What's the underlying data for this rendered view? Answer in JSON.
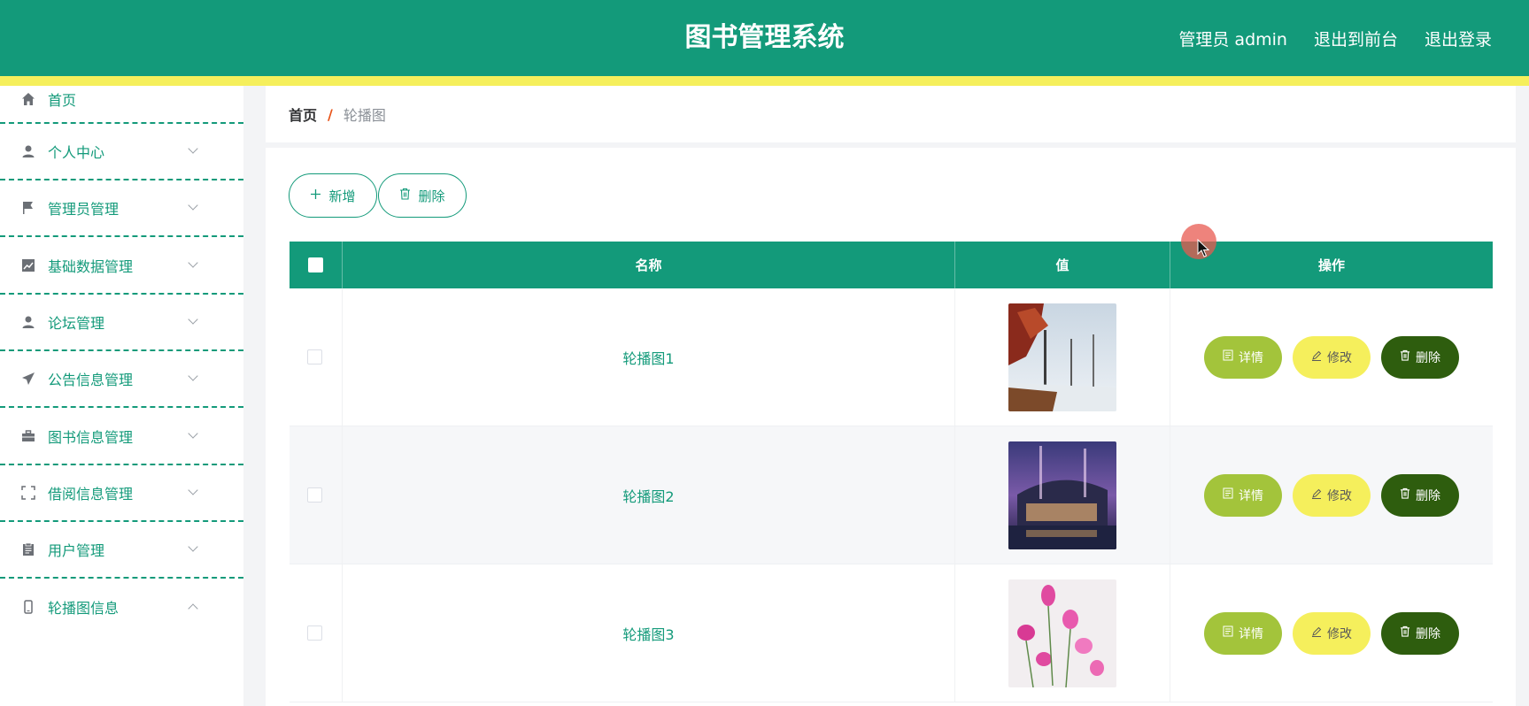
{
  "header": {
    "title": "图书管理系统",
    "user_label": "管理员 admin",
    "exit_front": "退出到前台",
    "logout": "退出登录"
  },
  "sidebar": {
    "items": [
      {
        "label": "首页",
        "icon": "home-icon",
        "has_chevron": false
      },
      {
        "label": "个人中心",
        "icon": "user-icon",
        "has_chevron": true
      },
      {
        "label": "管理员管理",
        "icon": "flag-icon",
        "has_chevron": true
      },
      {
        "label": "基础数据管理",
        "icon": "chart-icon",
        "has_chevron": true
      },
      {
        "label": "论坛管理",
        "icon": "person-icon",
        "has_chevron": true
      },
      {
        "label": "公告信息管理",
        "icon": "send-icon",
        "has_chevron": true
      },
      {
        "label": "图书信息管理",
        "icon": "briefcase-icon",
        "has_chevron": true
      },
      {
        "label": "借阅信息管理",
        "icon": "fullscreen-icon",
        "has_chevron": true
      },
      {
        "label": "用户管理",
        "icon": "clipboard-icon",
        "has_chevron": true
      },
      {
        "label": "轮播图信息",
        "icon": "phone-icon",
        "has_chevron": true,
        "expanded": true
      }
    ]
  },
  "breadcrumb": {
    "home": "首页",
    "separator": "/",
    "current": "轮播图"
  },
  "toolbar": {
    "add_label": "新增",
    "delete_label": "删除"
  },
  "table": {
    "columns": [
      "名称",
      "值",
      "操作"
    ],
    "rows": [
      {
        "name": "轮播图1",
        "image": "winter-trees-photo"
      },
      {
        "name": "轮播图2",
        "image": "night-building-photo"
      },
      {
        "name": "轮播图3",
        "image": "pink-flowers-photo"
      }
    ],
    "actions": {
      "detail": "详情",
      "edit": "修改",
      "delete": "删除"
    }
  },
  "colors": {
    "primary": "#139a7a",
    "accent_yellow": "#f5ef5c",
    "detail_btn": "#a3c43b",
    "delete_btn": "#2e5d0e"
  }
}
